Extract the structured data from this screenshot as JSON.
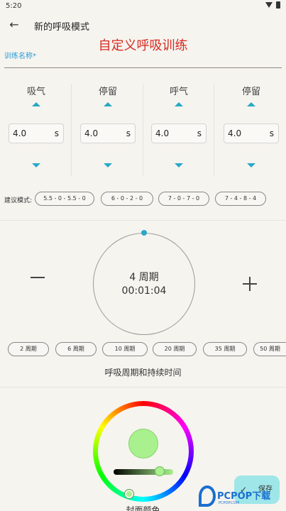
{
  "status_bar": {
    "time": "5:20"
  },
  "app_bar": {
    "title": "新的呼吸模式"
  },
  "overlay_title": "自定义呼吸训练",
  "name_field": {
    "label": "训练名称*"
  },
  "phases": [
    {
      "label": "吸气",
      "value": "4.0",
      "unit": "s"
    },
    {
      "label": "停留",
      "value": "4.0",
      "unit": "s"
    },
    {
      "label": "呼气",
      "value": "4.0",
      "unit": "s"
    },
    {
      "label": "停留",
      "value": "4.0",
      "unit": "s"
    }
  ],
  "suggested_modes": {
    "label": "建议模式:",
    "items": [
      "5.5 - 0 - 5.5 - 0",
      "6 - 0 - 2 - 0",
      "7 - 0 - 7 - 0",
      "7 - 4 - 8 - 4"
    ]
  },
  "cycle_dial": {
    "cycles": "4 周期",
    "duration": "00:01:04"
  },
  "cycle_presets": [
    "2 周期",
    "6 周期",
    "10 周期",
    "20 周期",
    "35 周期",
    "50 周期"
  ],
  "cycle_caption": "呼吸周期和持续时间",
  "cover_color": {
    "label": "封面颜色",
    "color": "#a9f08f"
  },
  "save_button": {
    "label": "保存"
  },
  "watermark": {
    "brand": "PCPOP下载",
    "sub": "PCPOP.COM"
  },
  "colors": {
    "accent": "#2aa8c8",
    "title_red": "#d62b22",
    "label_blue": "#2a9bd8",
    "background": "#f6f4ef"
  }
}
